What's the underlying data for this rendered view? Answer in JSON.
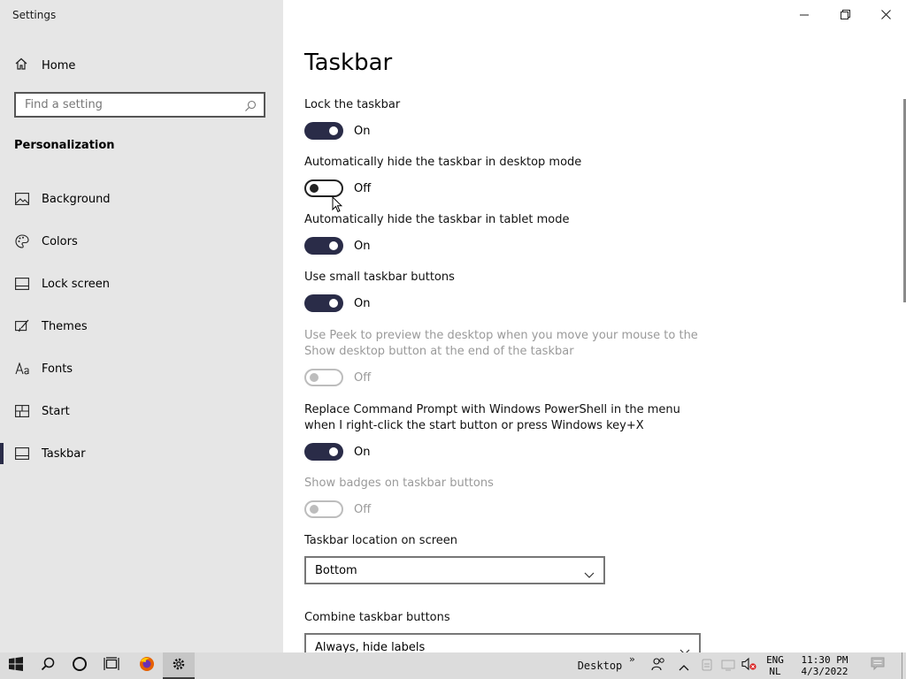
{
  "window": {
    "title": "Settings"
  },
  "sidebar": {
    "home_label": "Home",
    "search_placeholder": "Find a setting",
    "section_title": "Personalization",
    "items": [
      {
        "label": "Background",
        "icon": "image-icon"
      },
      {
        "label": "Colors",
        "icon": "palette-icon"
      },
      {
        "label": "Lock screen",
        "icon": "lock-screen-icon"
      },
      {
        "label": "Themes",
        "icon": "brush-icon"
      },
      {
        "label": "Fonts",
        "icon": "font-icon"
      },
      {
        "label": "Start",
        "icon": "start-icon"
      },
      {
        "label": "Taskbar",
        "icon": "taskbar-icon",
        "active": true
      }
    ]
  },
  "main": {
    "title": "Taskbar",
    "settings": [
      {
        "label": "Lock the taskbar",
        "state": "On",
        "enabled": true
      },
      {
        "label": "Automatically hide the taskbar in desktop mode",
        "state": "Off",
        "enabled": true
      },
      {
        "label": "Automatically hide the taskbar in tablet mode",
        "state": "On",
        "enabled": true
      },
      {
        "label": "Use small taskbar buttons",
        "state": "On",
        "enabled": true
      },
      {
        "label_line1": "Use Peek to preview the desktop when you move your mouse to the",
        "label_line2": "Show desktop button at the end of the taskbar",
        "state": "Off",
        "enabled": false
      },
      {
        "label_line1": "Replace Command Prompt with Windows PowerShell in the menu",
        "label_line2": "when I right-click the start button or press Windows key+X",
        "state": "On",
        "enabled": true
      },
      {
        "label": "Show badges on taskbar buttons",
        "state": "Off",
        "enabled": false
      }
    ],
    "location": {
      "label": "Taskbar location on screen",
      "value": "Bottom"
    },
    "combine": {
      "label": "Combine taskbar buttons",
      "value": "Always, hide labels"
    }
  },
  "taskbar": {
    "desktop_label": "Desktop",
    "overflow": "»",
    "language_line1": "ENG",
    "language_line2": "NL",
    "time": "11:30 PM",
    "date": "4/3/2022"
  },
  "colors": {
    "accent": "#2a2c48",
    "sidebar_bg": "#e6e6e6",
    "taskbar_bg": "#dcdcdc"
  }
}
